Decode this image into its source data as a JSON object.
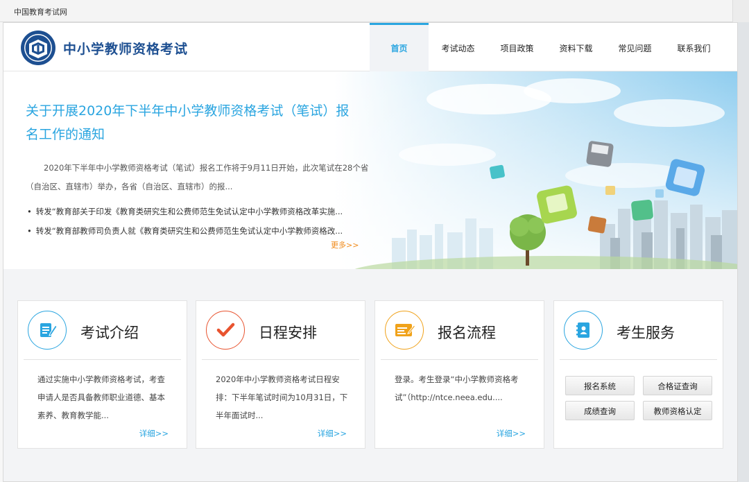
{
  "window": {
    "site_name": "中国教育考试网"
  },
  "header": {
    "brand": "中小学教师资格考试",
    "nav": [
      {
        "label": "首页",
        "active": true
      },
      {
        "label": "考试动态"
      },
      {
        "label": "项目政策"
      },
      {
        "label": "资料下载"
      },
      {
        "label": "常见问题"
      },
      {
        "label": "联系我们"
      }
    ]
  },
  "hero": {
    "title": "关于开展2020年下半年中小学教师资格考试（笔试）报名工作的通知",
    "summary": "2020年下半年中小学教师资格考试（笔试）报名工作将于9月11日开始，此次笔试在28个省（自治区、直辖市）举办，各省（自治区、直辖市）的报...",
    "links": [
      "转发“教育部关于印发《教育类研究生和公费师范生免试认定中小学教师资格改革实施...",
      "转发“教育部教师司负责人就《教育类研究生和公费师范生免试认定中小学教师资格改..."
    ],
    "more": "更多>>"
  },
  "cards": [
    {
      "title": "考试介绍",
      "desc": "通过实施中小学教师资格考试，考查申请人是否具备教师职业道德、基本素养、教育教学能...",
      "more": "详细>>",
      "icon": "document-edit-icon",
      "color": "#2aa5e0"
    },
    {
      "title": "日程安排",
      "desc": "2020年中小学教师资格考试日程安排：下半年笔试时间为10月31日，下半年面试时...",
      "more": "详细>>",
      "icon": "checkmark-icon",
      "color": "#e8532f"
    },
    {
      "title": "报名流程",
      "desc": "登录。考生登录“中小学教师资格考试”（http://ntce.neea.edu....",
      "more": "详细>>",
      "icon": "form-icon",
      "color": "#f0a21a"
    },
    {
      "title": "考生服务",
      "icon": "contact-card-icon",
      "color": "#2aa5e0",
      "buttons": [
        "报名系统",
        "合格证查询",
        "成绩查询",
        "教师资格认定"
      ]
    }
  ]
}
